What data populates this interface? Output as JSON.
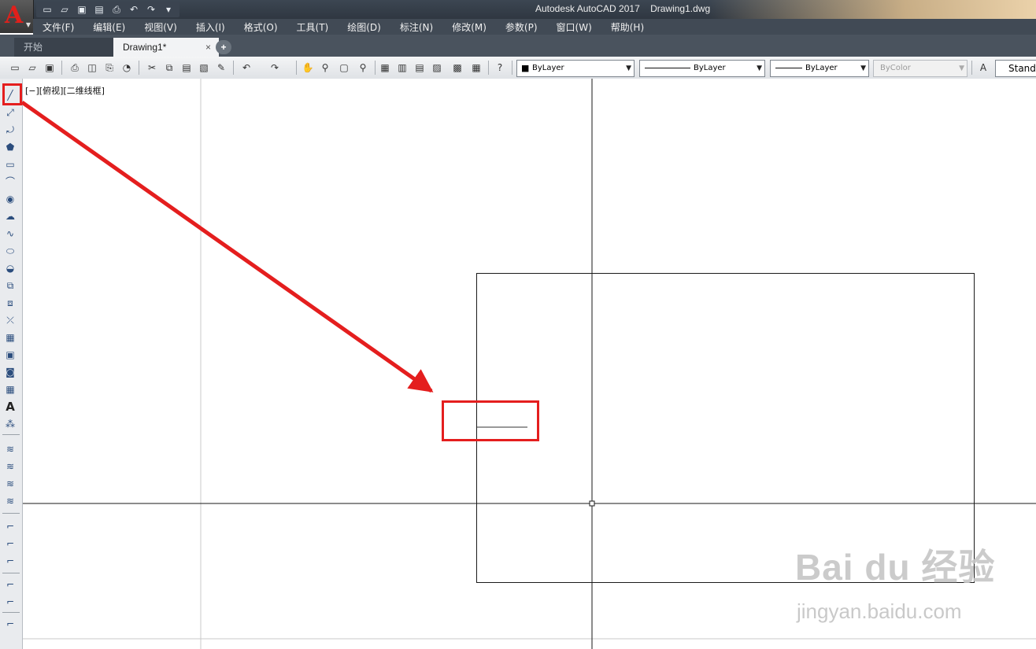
{
  "app": {
    "logo_letter": "A",
    "title": "Autodesk AutoCAD 2017    Drawing1.dwg"
  },
  "quick_access": [
    "new-icon",
    "open-icon",
    "save-icon",
    "saveas-icon",
    "print-icon",
    "undo-icon",
    "redo-icon",
    "customize-icon"
  ],
  "menu": [
    "文件(F)",
    "编辑(E)",
    "视图(V)",
    "插入(I)",
    "格式(O)",
    "工具(T)",
    "绘图(D)",
    "标注(N)",
    "修改(M)",
    "参数(P)",
    "窗口(W)",
    "帮助(H)"
  ],
  "tabs": {
    "start": "开始",
    "active": "Drawing1*",
    "close": "×",
    "new": "+"
  },
  "properties": {
    "color": "ByLayer",
    "linetype": "ByLayer",
    "lineweight": "ByLayer",
    "plotstyle": "ByColor",
    "textstyle": "Standa"
  },
  "viewport": {
    "label": "[−][俯视][二维线框]"
  },
  "watermark": {
    "brand": "Bai du 经验",
    "url": "jingyan.baidu.com"
  },
  "colors": {
    "highlight": "#e41e1e",
    "titlebar": "#3c4652",
    "menubar": "#414a55"
  }
}
